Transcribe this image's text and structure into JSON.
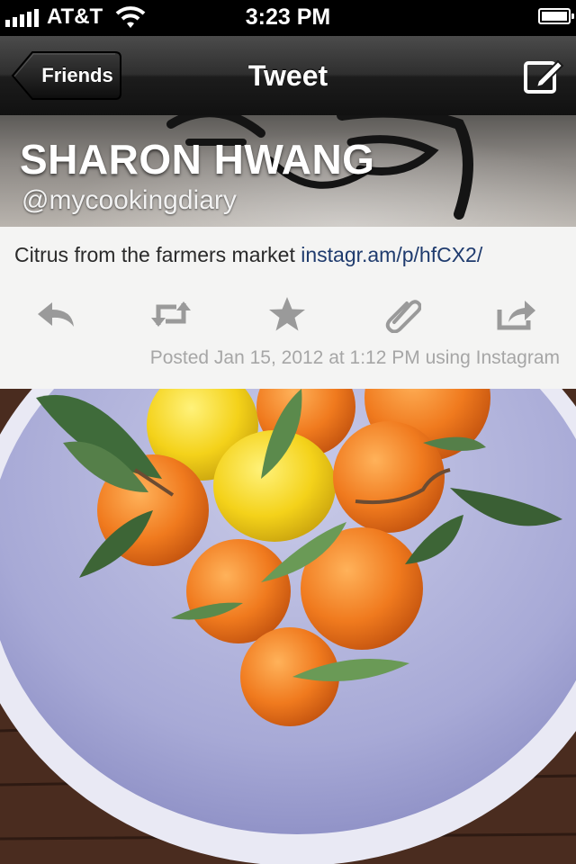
{
  "status_bar": {
    "carrier": "AT&T",
    "time": "3:23 PM",
    "signal_bars": 5,
    "battery_level": 1.0
  },
  "nav": {
    "back_label": "Friends",
    "title": "Tweet",
    "compose_icon": "compose-icon"
  },
  "profile": {
    "name": "SHARON HWANG",
    "handle": "@mycookingdiary"
  },
  "tweet": {
    "text": "Citrus from the farmers market",
    "link": "instagr.am/p/hfCX2/",
    "posted": "Posted Jan 15, 2012 at 1:12 PM using Instagram",
    "actions": [
      "reply-icon",
      "retweet-icon",
      "favorite-icon",
      "attach-icon",
      "share-icon"
    ]
  },
  "photo": {
    "subject": "bowl-of-citrus-image"
  },
  "colors": {
    "nav_top": "#4b4b4b",
    "nav_bottom": "#111111",
    "link": "#1f3b6e",
    "card_bg": "#f4f4f3",
    "meta_text": "#a6a6a6",
    "icon_gray": "#9a9a9a"
  }
}
